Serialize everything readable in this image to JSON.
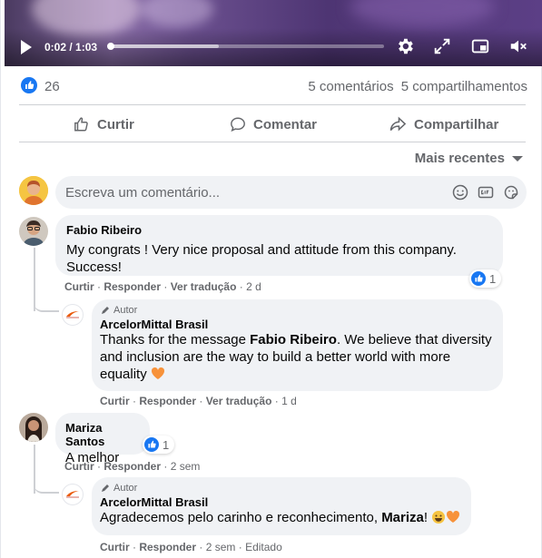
{
  "video": {
    "time_current": "0:02",
    "time_total": "1:03",
    "progress": 0.01,
    "buffered": 0.4,
    "icons": [
      "play-icon",
      "settings-gear-icon",
      "fullscreen-icon",
      "miniplayer-icon",
      "volume-muted-icon"
    ]
  },
  "stats": {
    "like_count": "26",
    "comments": "5 comentários",
    "shares": "5 compartilhamentos"
  },
  "actions": {
    "like": "Curtir",
    "comment": "Comentar",
    "share": "Compartilhar"
  },
  "sort": {
    "label": "Mais recentes"
  },
  "composer": {
    "placeholder": "Escreva um comentário..."
  },
  "comments": [
    {
      "name": "Fabio Ribeiro",
      "text": "My congrats ! Very nice proposal and attitude from this company. Success!",
      "reaction_count": "1",
      "meta": {
        "like": "Curtir",
        "reply": "Responder",
        "translate": "Ver tradução",
        "time": "2 d"
      },
      "reply": {
        "author_badge": "Autor",
        "name": "ArcelorMittal Brasil",
        "text_before": "Thanks for the message ",
        "text_bold": "Fabio Ribeiro",
        "text_after": ". We believe that diversity and inclusion are the way to build a better world with more equality",
        "meta": {
          "like": "Curtir",
          "reply": "Responder",
          "translate": "Ver tradução",
          "time": "1 d"
        }
      }
    },
    {
      "name": "Mariza Santos",
      "text": "A melhor",
      "reaction_count": "1",
      "meta": {
        "like": "Curtir",
        "reply": "Responder",
        "time": "2 sem"
      },
      "reply": {
        "author_badge": "Autor",
        "name": "ArcelorMittal Brasil",
        "text_before": "Agradecemos pelo carinho e reconhecimento, ",
        "text_bold": "Mariza",
        "text_after": "!",
        "meta": {
          "like": "Curtir",
          "reply": "Responder",
          "time": "2 sem",
          "edited": "Editado"
        }
      }
    }
  ],
  "colors": {
    "facebook_blue": "#1877f2",
    "secondary_text": "#65676b",
    "bubble_bg": "#f0f2f5",
    "heart_orange": "#f7923a"
  }
}
